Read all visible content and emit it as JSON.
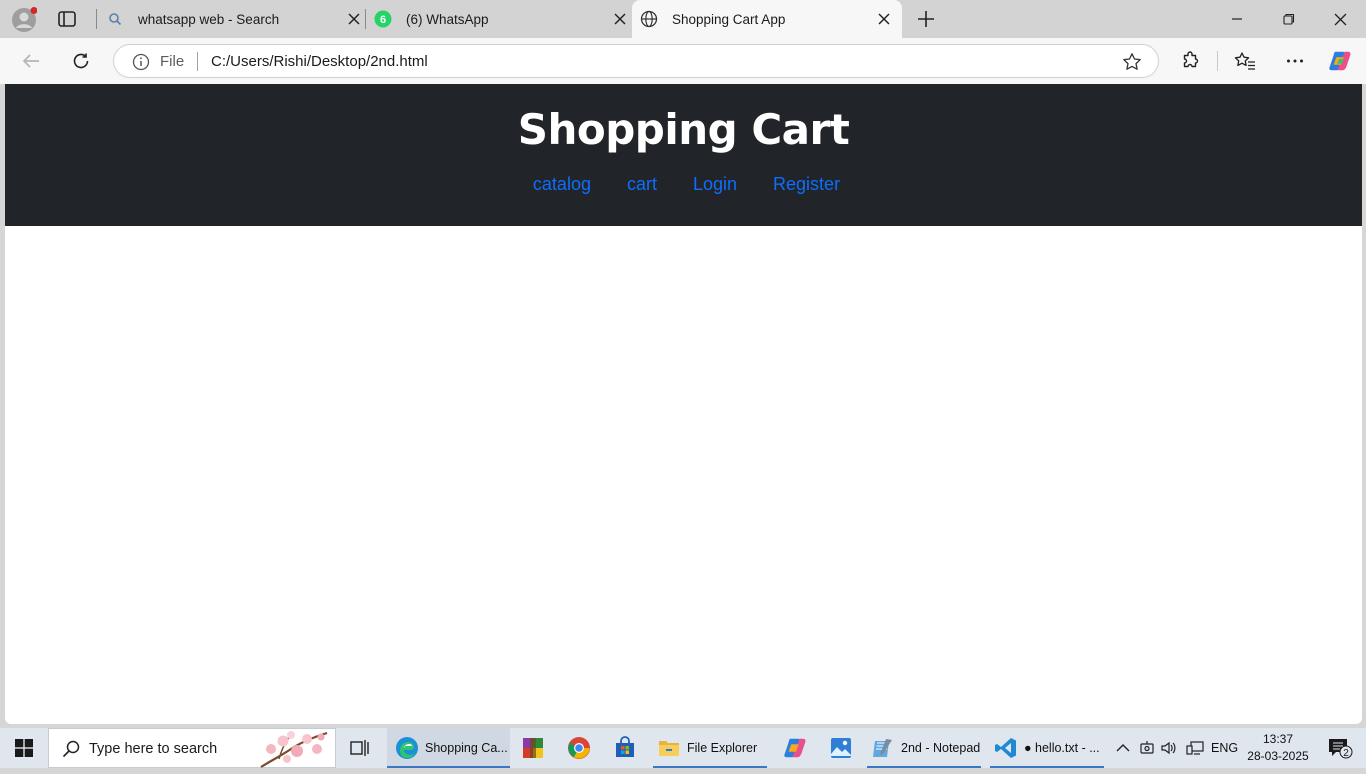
{
  "browser": {
    "tabs": [
      {
        "title": "whatsapp web - Search",
        "icon": "search-icon"
      },
      {
        "title": "(6) WhatsApp",
        "icon": "whatsapp-icon",
        "badge": "6"
      },
      {
        "title": "Shopping Cart App",
        "icon": "globe-icon",
        "active": true
      }
    ],
    "address": {
      "scheme_label": "File",
      "url": "C:/Users/Rishi/Desktop/2nd.html"
    }
  },
  "page": {
    "title": "Shopping Cart",
    "nav": [
      "catalog",
      "cart",
      "Login",
      "Register"
    ],
    "colors": {
      "header_bg": "#212529",
      "link": "#0d6efd"
    }
  },
  "taskbar": {
    "search_placeholder": "Type here to search",
    "apps": [
      {
        "label": "Shopping Ca...",
        "icon": "edge-icon",
        "active": true
      },
      {
        "label": "",
        "icon": "winrar-icon"
      },
      {
        "label": "",
        "icon": "chrome-icon"
      },
      {
        "label": "",
        "icon": "store-icon"
      },
      {
        "label": "File Explorer",
        "icon": "folder-icon"
      },
      {
        "label": "",
        "icon": "copilot-icon"
      },
      {
        "label": "",
        "icon": "photos-icon"
      },
      {
        "label": "2nd - Notepad",
        "icon": "notepad-icon"
      },
      {
        "label": "● hello.txt - ...",
        "icon": "vscode-icon"
      }
    ],
    "tray": {
      "language": "ENG",
      "time": "13:37",
      "date": "28-03-2025",
      "notifications": "2"
    }
  }
}
